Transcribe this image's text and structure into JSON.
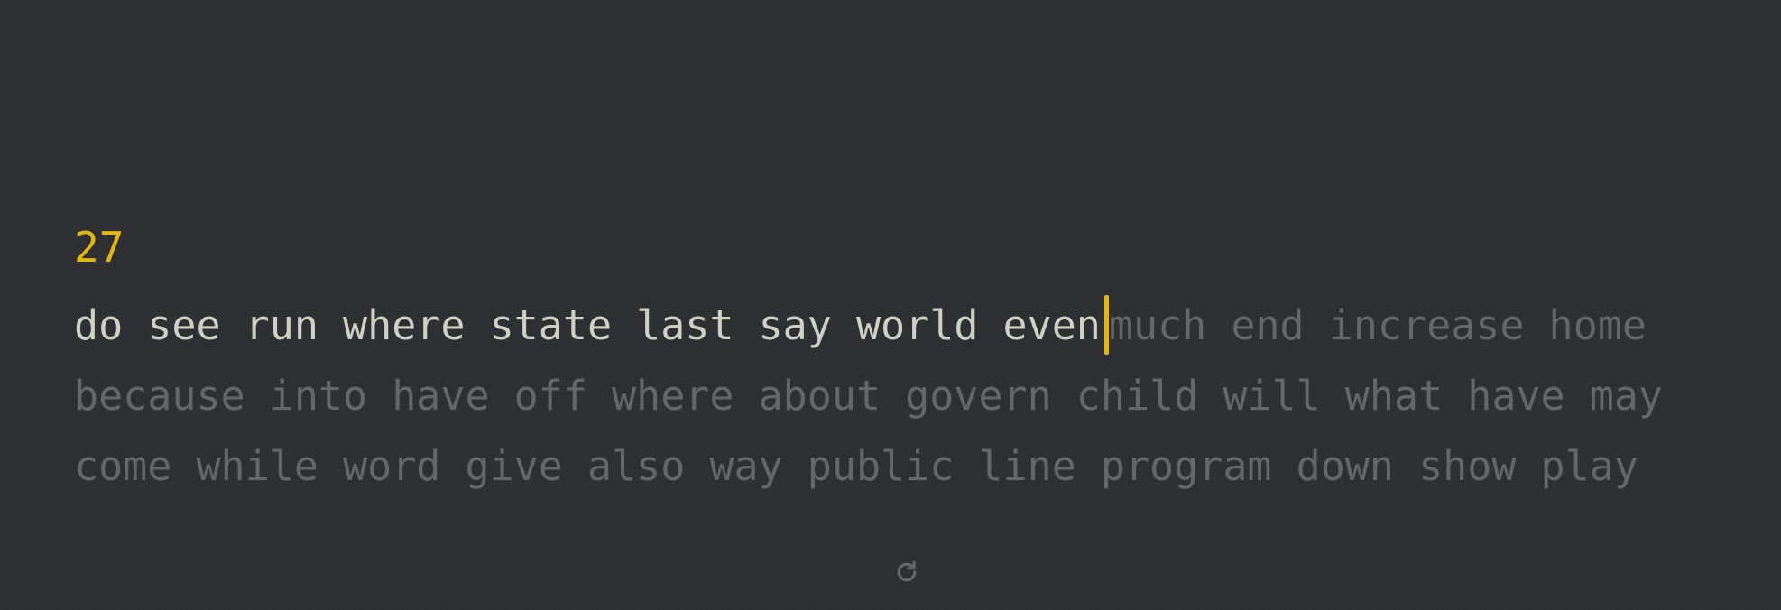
{
  "test": {
    "counter": "27",
    "typed_text": "do see run where state last say world even",
    "lines": [
      {
        "upcoming": "much end increase home"
      },
      {
        "upcoming": "because into have off where about govern child will what have may"
      },
      {
        "upcoming": "come while word give also way public line program down show play"
      }
    ]
  },
  "icons": {
    "restart": "restart-icon"
  },
  "colors": {
    "background": "#2c2e31",
    "accent": "#e2b714",
    "typed": "#d1d0c5",
    "untyped": "#646669"
  }
}
